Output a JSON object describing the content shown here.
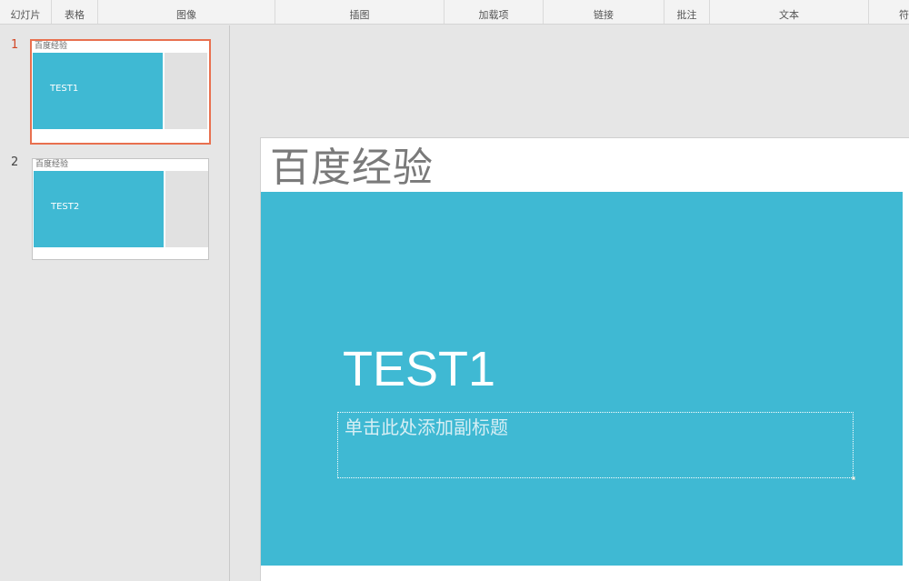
{
  "ribbon": {
    "groups": [
      {
        "label": "幻灯片"
      },
      {
        "label": "表格"
      },
      {
        "label": "图像"
      },
      {
        "label": "插图"
      },
      {
        "label": "加载项"
      },
      {
        "label": "链接"
      },
      {
        "label": "批注"
      },
      {
        "label": "文本"
      },
      {
        "label": "符"
      }
    ]
  },
  "slides": [
    {
      "number": "1",
      "title": "百度经验",
      "text": "TEST1",
      "selected": true
    },
    {
      "number": "2",
      "title": "百度经验",
      "text": "TEST2",
      "selected": false
    }
  ],
  "editor": {
    "title": "百度经验",
    "main_text": "TEST1",
    "subtitle_placeholder": "单击此处添加副标题"
  },
  "colors": {
    "accent_blue": "#3fb9d3",
    "selection": "#e8704f"
  }
}
